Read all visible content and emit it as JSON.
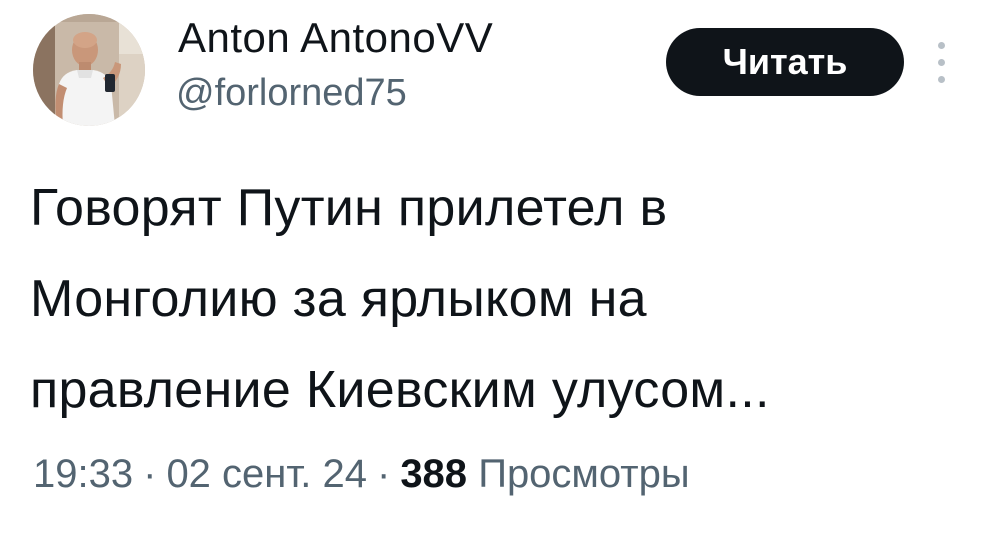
{
  "author": {
    "display_name": "Anton AntonoVV",
    "handle": "@forlorned75"
  },
  "follow_button": {
    "label": "Читать"
  },
  "more_button": {
    "icon": "more-vertical-icon"
  },
  "tweet": {
    "text_lines": [
      "Говорят Путин прилетел в",
      "Монголию за ярлыком на",
      "правление Киевским улусом..."
    ]
  },
  "meta": {
    "time": "19:33",
    "separator": "·",
    "date": "02 сент. 24",
    "views_count": "388",
    "views_label": "Просмотры"
  },
  "colors": {
    "primary_text": "#0f1419",
    "secondary_text": "#536471",
    "button_bg": "#0f1419",
    "button_text": "#ffffff"
  }
}
